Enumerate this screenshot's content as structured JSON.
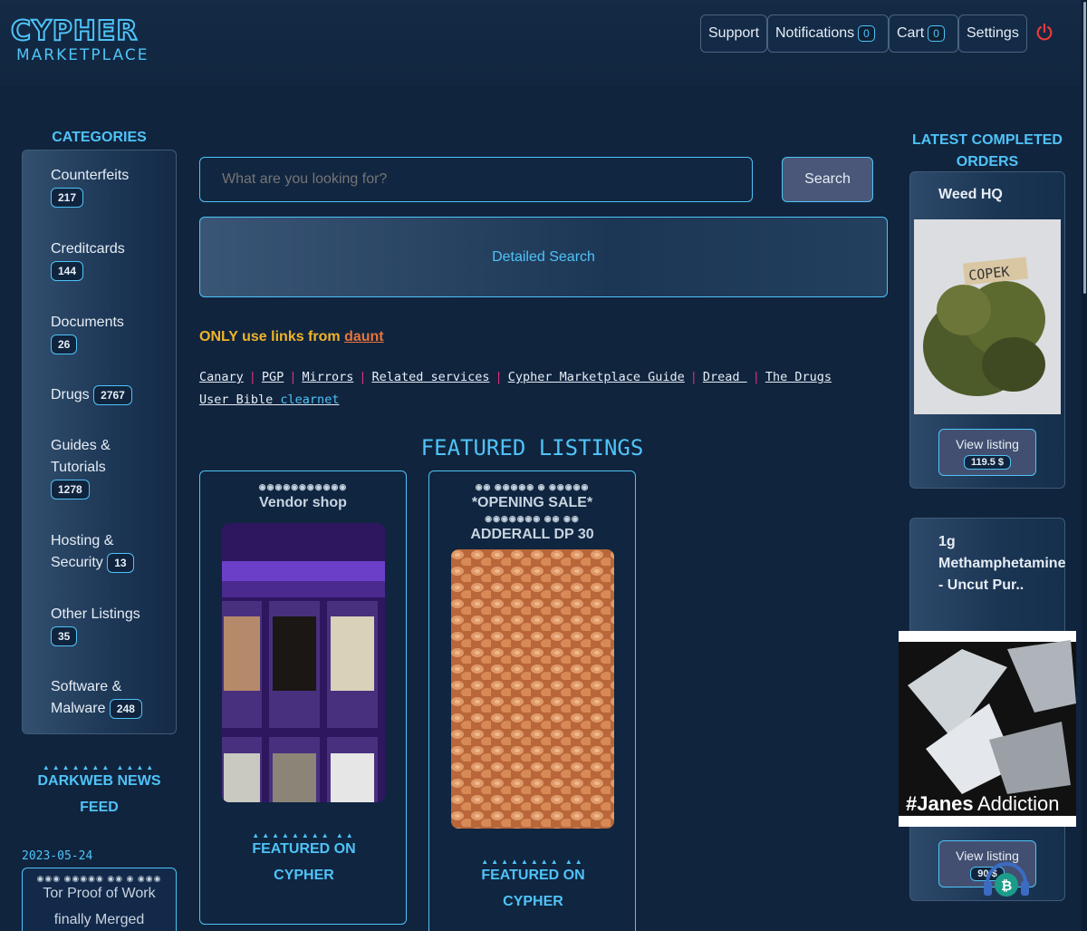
{
  "brand": {
    "logo_top": "CYPHER",
    "logo_sub": "MARKETPLACE",
    "accent": "#4fc3f7"
  },
  "nav": {
    "support": "Support",
    "notifications": "Notifications",
    "notifications_count": "0",
    "cart": "Cart",
    "cart_count": "0",
    "settings": "Settings",
    "logout_icon": "power-icon"
  },
  "categories": {
    "title": "CATEGORIES",
    "items": [
      {
        "label": "Counterfeits",
        "count": "217"
      },
      {
        "label": "Creditcards",
        "count": "144"
      },
      {
        "label": "Documents",
        "count": "26"
      },
      {
        "label": "Drugs",
        "count": "2767"
      },
      {
        "label": "Guides & Tutorials",
        "count": "1278"
      },
      {
        "label": "Hosting & Security",
        "count": "13"
      },
      {
        "label": "Other Listings",
        "count": "35"
      },
      {
        "label": "Software & Malware",
        "count": "248"
      }
    ]
  },
  "news": {
    "title": "DARKWEB NEWS FEED",
    "date": "2023-05-24",
    "headline": "Tor Proof of Work finally Merged"
  },
  "search": {
    "placeholder": "What are you looking for?",
    "button": "Search",
    "detailed": "Detailed Search"
  },
  "warning": {
    "text": "ONLY use links from",
    "link": "daunt"
  },
  "links": {
    "canary": "Canary",
    "pgp": "PGP",
    "mirrors": "Mirrors",
    "related": "Related services",
    "guide": "Cypher Marketplace Guide",
    "dread": "Dread ",
    "the_drugs": "The Drugs",
    "user_bible": "User Bible",
    "clearnet": "clearnet"
  },
  "featured": {
    "title": "FEATURED LISTINGS",
    "cards": [
      {
        "title": "Vendor shop",
        "badge": "FEATURED ON CYPHER"
      },
      {
        "title_line1": "*OPENING SALE*",
        "title_line2": "ADDERALL DP 30",
        "badge": "FEATURED ON CYPHER"
      }
    ]
  },
  "latest": {
    "title": "LATEST COMPLETED ORDERS",
    "orders": [
      {
        "title": "Weed HQ",
        "image_text": "COPEK",
        "button": "View listing",
        "price": "119.5 $"
      },
      {
        "title": "1g Methamphetamine - Uncut Pur..",
        "image_text_bold": "#Janes",
        "image_text": "Addiction",
        "button": "View listing",
        "price": "90 $"
      }
    ]
  }
}
